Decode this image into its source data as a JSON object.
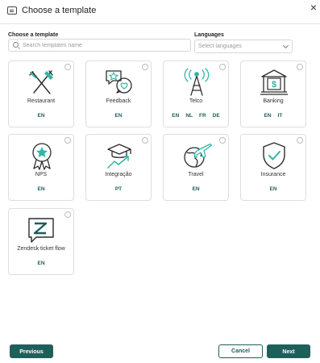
{
  "header": {
    "title": "Choose a template",
    "close": "×"
  },
  "filters": {
    "template_label": "Choose a template",
    "search_placeholder": "Search templates name",
    "languages_label": "Languages",
    "languages_placeholder": "Select languages"
  },
  "templates": [
    {
      "name": "Restaurant",
      "icon": "restaurant-icon",
      "languages": [
        "EN"
      ]
    },
    {
      "name": "Feedback",
      "icon": "feedback-icon",
      "languages": [
        "EN"
      ]
    },
    {
      "name": "Telco",
      "icon": "telco-icon",
      "languages": [
        "EN",
        "NL",
        "FR",
        "DE"
      ]
    },
    {
      "name": "Banking",
      "icon": "bank-icon",
      "languages": [
        "EN",
        "IT"
      ]
    },
    {
      "name": "NPS",
      "icon": "nps-icon",
      "languages": [
        "EN"
      ]
    },
    {
      "name": "Integração",
      "icon": "integration-icon",
      "languages": [
        "PT"
      ]
    },
    {
      "name": "Travel",
      "icon": "travel-icon",
      "languages": [
        "EN"
      ]
    },
    {
      "name": "Insurance",
      "icon": "insurance-icon",
      "languages": [
        "EN"
      ]
    },
    {
      "name": "Zendesk ticket flow",
      "icon": "zendesk-icon",
      "languages": [
        "EN"
      ]
    }
  ],
  "footer": {
    "previous_label": "Previous",
    "cancel_label": "Cancel",
    "next_label": "Next"
  },
  "colors": {
    "accent": "#1f5f5b",
    "icon_teal": "#2fb6a6",
    "border": "#dedede"
  }
}
